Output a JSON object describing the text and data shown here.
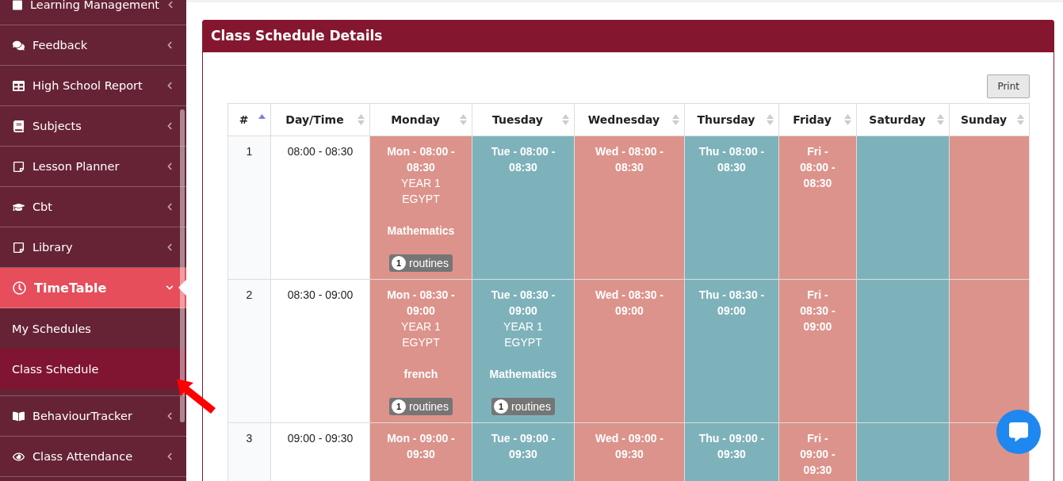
{
  "sidebar": {
    "items": [
      {
        "label": "Learning Management",
        "expanded": false,
        "selected": false
      },
      {
        "label": "Feedback",
        "expanded": false,
        "selected": false
      },
      {
        "label": "High School Report",
        "expanded": false,
        "selected": false
      },
      {
        "label": "Subjects",
        "expanded": false,
        "selected": false
      },
      {
        "label": "Lesson Planner",
        "expanded": false,
        "selected": false
      },
      {
        "label": "Cbt",
        "expanded": false,
        "selected": false
      },
      {
        "label": "Library",
        "expanded": false,
        "selected": false
      },
      {
        "label": "TimeTable",
        "expanded": true,
        "selected": true,
        "children": [
          {
            "label": "My Schedules",
            "selected": false
          },
          {
            "label": "Class Schedule",
            "selected": true
          }
        ]
      },
      {
        "label": "BehaviourTracker",
        "expanded": false,
        "selected": false
      },
      {
        "label": "Class Attendance",
        "expanded": false,
        "selected": false
      }
    ]
  },
  "panel": {
    "title": "Class Schedule Details",
    "print_button": "Print",
    "table": {
      "columns": [
        {
          "label": "#",
          "sorted": true
        },
        {
          "label": "Day/Time",
          "sorted": false
        },
        {
          "label": "Monday",
          "sorted": false
        },
        {
          "label": "Tuesday",
          "sorted": false
        },
        {
          "label": "Wednesday",
          "sorted": false
        },
        {
          "label": "Thursday",
          "sorted": false
        },
        {
          "label": "Friday",
          "sorted": false
        },
        {
          "label": "Saturday",
          "sorted": false
        },
        {
          "label": "Sunday",
          "sorted": false
        }
      ],
      "rows": [
        {
          "cells": [
            {
              "kind": "index",
              "text": "1"
            },
            {
              "kind": "time",
              "text": "08:00 - 08:30"
            },
            {
              "kind": "slot",
              "color": "#dc938b",
              "title": "Mon - 08:00 - 08:30",
              "class": "YEAR 1 EGYPT",
              "subject": "Mathematics",
              "count": "1",
              "badge": "routines"
            },
            {
              "kind": "slot",
              "color": "#7eb2bb",
              "title": "Tue - 08:00 - 08:30"
            },
            {
              "kind": "slot",
              "color": "#dc938b",
              "title": "Wed - 08:00 - 08:30"
            },
            {
              "kind": "slot",
              "color": "#7eb2bb",
              "title": "Thu - 08:00 - 08:30"
            },
            {
              "kind": "slot",
              "color": "#dc938b",
              "title": "Fri - 08:00 - 08:30"
            },
            {
              "kind": "slot",
              "color": "#7eb2bb"
            },
            {
              "kind": "slot",
              "color": "#dc938b"
            }
          ]
        },
        {
          "cells": [
            {
              "kind": "index",
              "text": "2"
            },
            {
              "kind": "time",
              "text": "08:30 - 09:00"
            },
            {
              "kind": "slot",
              "color": "#dc938b",
              "title": "Mon - 08:30 - 09:00",
              "class": "YEAR 1 EGYPT",
              "subject": "french",
              "count": "1",
              "badge": "routines"
            },
            {
              "kind": "slot",
              "color": "#7eb2bb",
              "title": "Tue - 08:30 - 09:00",
              "class": "YEAR 1 EGYPT",
              "subject": "Mathematics",
              "count": "1",
              "badge": "routines"
            },
            {
              "kind": "slot",
              "color": "#dc938b",
              "title": "Wed - 08:30 - 09:00"
            },
            {
              "kind": "slot",
              "color": "#7eb2bb",
              "title": "Thu - 08:30 - 09:00"
            },
            {
              "kind": "slot",
              "color": "#dc938b",
              "title": "Fri - 08:30 - 09:00"
            },
            {
              "kind": "slot",
              "color": "#7eb2bb"
            },
            {
              "kind": "slot",
              "color": "#dc938b"
            }
          ]
        },
        {
          "cells": [
            {
              "kind": "index",
              "text": "3"
            },
            {
              "kind": "time",
              "text": "09:00 - 09:30"
            },
            {
              "kind": "slot",
              "color": "#dc938b",
              "title": "Mon - 09:00 - 09:30"
            },
            {
              "kind": "slot",
              "color": "#7eb2bb",
              "title": "Tue - 09:00 - 09:30"
            },
            {
              "kind": "slot",
              "color": "#dc938b",
              "title": "Wed - 09:00 - 09:30"
            },
            {
              "kind": "slot",
              "color": "#7eb2bb",
              "title": "Thu - 09:00 - 09:30"
            },
            {
              "kind": "slot",
              "color": "#dc938b",
              "title": "Fri - 09:00 - 09:30"
            },
            {
              "kind": "slot",
              "color": "#7eb2bb"
            },
            {
              "kind": "slot",
              "color": "#dc938b"
            }
          ]
        }
      ]
    }
  }
}
